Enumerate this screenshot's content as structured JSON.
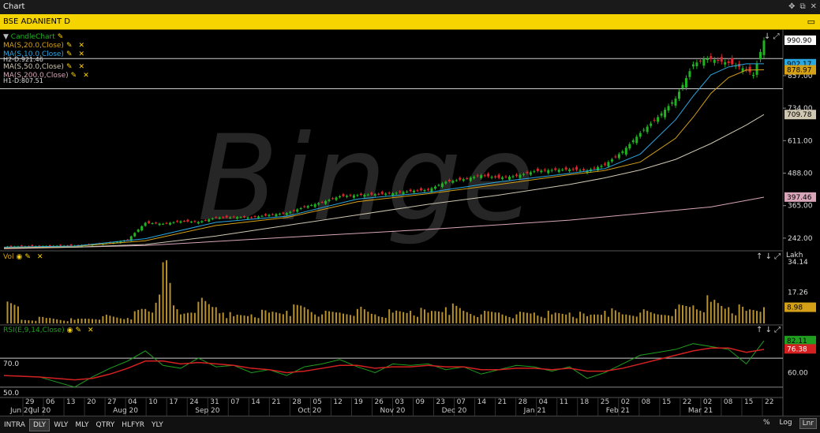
{
  "window": {
    "title": "Chart"
  },
  "symbol": {
    "label": "BSE ADANIENT D"
  },
  "legend": {
    "candle": "CandleChart",
    "ma20": "MA(S,20.0,Close)",
    "ma10": "MA(S,10.0,Close)",
    "h2": "H2-D:921.46",
    "ma50": "MA(S,50.0,Close)",
    "ma200": "MA(S,200.0,Close)",
    "h1": "H1-D:807.51",
    "vol": "Vol",
    "rsi": "RSI(E,9,14,Close)",
    "lakh": "Lakh"
  },
  "colors": {
    "candle_up": "#1fb31f",
    "candle_down": "#e0262c",
    "ma10": "#2aa6e0",
    "ma20": "#d4a017",
    "ma50": "#cfc7b2",
    "ma200": "#d8a6b8",
    "vol": "#b8912a",
    "rsi": "#1f9e1f",
    "rsi_signal": "#d42020",
    "symbol_bar": "#f5d400"
  },
  "price_axis": {
    "ticks": [
      "857.00",
      "734.00",
      "611.00",
      "488.00",
      "365.00",
      "242.00"
    ],
    "tags": {
      "last": "990.90",
      "ma10": "902.17",
      "ma20": "878.97",
      "ma50": "709.78",
      "ma200": "397.46"
    }
  },
  "vol_axis": {
    "ticks": [
      "34.14",
      "17.26"
    ],
    "tag": "8.98"
  },
  "rsi_axis": {
    "ticks": [
      "60.00"
    ],
    "tag_rsi": "82.11",
    "tag_signal": "76.38",
    "left_levels": [
      "70.0",
      "50.0"
    ]
  },
  "time_axis": {
    "days": [
      "29",
      "06",
      "13",
      "20",
      "27",
      "04",
      "10",
      "17",
      "24",
      "31",
      "07",
      "14",
      "21",
      "28",
      "05",
      "12",
      "19",
      "26",
      "03",
      "09",
      "23",
      "07",
      "14",
      "21",
      "28",
      "04",
      "11",
      "18",
      "25",
      "02",
      "08",
      "15",
      "22",
      "02",
      "08",
      "15",
      "22"
    ],
    "months": [
      "Jun 20",
      "Jul 20",
      "Aug 20",
      "Sep 20",
      "Oct 20",
      "Nov 20",
      "Dec 20",
      "Jan 21",
      "Feb 21",
      "Mar 21"
    ]
  },
  "chart_data": {
    "type": "line",
    "ylim": [
      200,
      1000
    ],
    "highlight_levels": [
      921.46,
      807.51
    ],
    "price": {
      "x": [
        0,
        5,
        10,
        15,
        20,
        25,
        30,
        35,
        40,
        45,
        50,
        55,
        60,
        63,
        65,
        70,
        75,
        80,
        85,
        90,
        95,
        100,
        105,
        110,
        115,
        120,
        125,
        130,
        135,
        140,
        145,
        150,
        155,
        160,
        165,
        170,
        175,
        180,
        185,
        190,
        195,
        198,
        200,
        203,
        205,
        207,
        210,
        212,
        215
      ],
      "values": [
        210,
        211,
        212,
        213,
        214,
        218,
        223,
        236,
        300,
        296,
        306,
        303,
        320,
        320,
        322,
        320,
        330,
        337,
        360,
        378,
        400,
        405,
        408,
        412,
        420,
        425,
        455,
        465,
        480,
        470,
        478,
        495,
        500,
        502,
        498,
        520,
        570,
        640,
        700,
        770,
        900,
        920,
        920,
        910,
        905,
        895,
        880,
        860,
        990
      ]
    },
    "ma10": {
      "x": [
        0,
        20,
        40,
        60,
        80,
        100,
        120,
        140,
        160,
        170,
        180,
        190,
        195,
        200,
        205,
        210,
        215
      ],
      "values": [
        208,
        212,
        240,
        302,
        325,
        390,
        415,
        455,
        487,
        505,
        560,
        690,
        780,
        860,
        890,
        902,
        902
      ]
    },
    "ma20": {
      "x": [
        0,
        20,
        40,
        60,
        80,
        100,
        120,
        140,
        160,
        170,
        180,
        190,
        195,
        200,
        205,
        210,
        215
      ],
      "values": [
        206,
        211,
        232,
        290,
        320,
        380,
        410,
        445,
        482,
        498,
        530,
        620,
        700,
        790,
        850,
        878,
        879
      ]
    },
    "ma50": {
      "x": [
        0,
        20,
        40,
        60,
        80,
        100,
        120,
        140,
        160,
        170,
        180,
        190,
        200,
        210,
        215
      ],
      "values": [
        205,
        208,
        218,
        250,
        290,
        330,
        370,
        405,
        445,
        470,
        500,
        540,
        600,
        670,
        710
      ]
    },
    "ma200": {
      "x": [
        0,
        40,
        80,
        120,
        160,
        200,
        215
      ],
      "values": [
        202,
        214,
        245,
        275,
        310,
        360,
        397
      ]
    },
    "volume": {
      "x": [
        5,
        12,
        20,
        28,
        35,
        40,
        42,
        45,
        48,
        50,
        55,
        60,
        62,
        65,
        70,
        75,
        80,
        85,
        90,
        95,
        100,
        105,
        110,
        115,
        120,
        125,
        130,
        135,
        140,
        145,
        150,
        155,
        160,
        165,
        170,
        175,
        180,
        185,
        190,
        195,
        200,
        205,
        210,
        215
      ],
      "values": [
        2,
        3,
        2,
        4,
        3,
        8,
        6,
        34,
        10,
        5,
        12,
        9,
        6,
        4,
        5,
        6,
        7,
        9,
        5,
        6,
        8,
        5,
        6,
        7,
        6,
        9,
        7,
        5,
        6,
        5,
        6,
        5,
        6,
        4,
        7,
        5,
        6,
        5,
        8,
        10,
        12,
        9,
        7,
        9
      ]
    },
    "rsi": {
      "x": [
        0,
        10,
        20,
        25,
        30,
        35,
        40,
        45,
        50,
        55,
        60,
        65,
        70,
        75,
        80,
        85,
        90,
        95,
        100,
        105,
        110,
        115,
        120,
        125,
        130,
        135,
        140,
        145,
        150,
        155,
        160,
        165,
        170,
        175,
        180,
        185,
        190,
        195,
        200,
        205,
        210,
        215
      ],
      "values": [
        58,
        57,
        50,
        57,
        63,
        68,
        75,
        65,
        63,
        70,
        64,
        65,
        60,
        62,
        58,
        64,
        66,
        69,
        64,
        60,
        66,
        65,
        66,
        62,
        64,
        59,
        62,
        65,
        64,
        61,
        64,
        56,
        60,
        66,
        72,
        74,
        76,
        80,
        78,
        76,
        66,
        82
      ]
    },
    "rsi_signal": {
      "x": [
        0,
        10,
        20,
        25,
        30,
        35,
        40,
        45,
        50,
        55,
        60,
        65,
        70,
        75,
        80,
        85,
        90,
        95,
        100,
        105,
        110,
        115,
        120,
        125,
        130,
        135,
        140,
        145,
        150,
        155,
        160,
        165,
        170,
        175,
        180,
        185,
        190,
        195,
        200,
        205,
        210,
        215
      ],
      "values": [
        58,
        57,
        55,
        56,
        59,
        63,
        68,
        68,
        66,
        67,
        66,
        65,
        63,
        62,
        60,
        61,
        63,
        65,
        65,
        63,
        64,
        64,
        65,
        64,
        64,
        62,
        62,
        63,
        63,
        62,
        63,
        61,
        61,
        63,
        66,
        69,
        72,
        75,
        77,
        77,
        74,
        76
      ]
    },
    "rsi_ylim": [
      45,
      88
    ]
  }
}
